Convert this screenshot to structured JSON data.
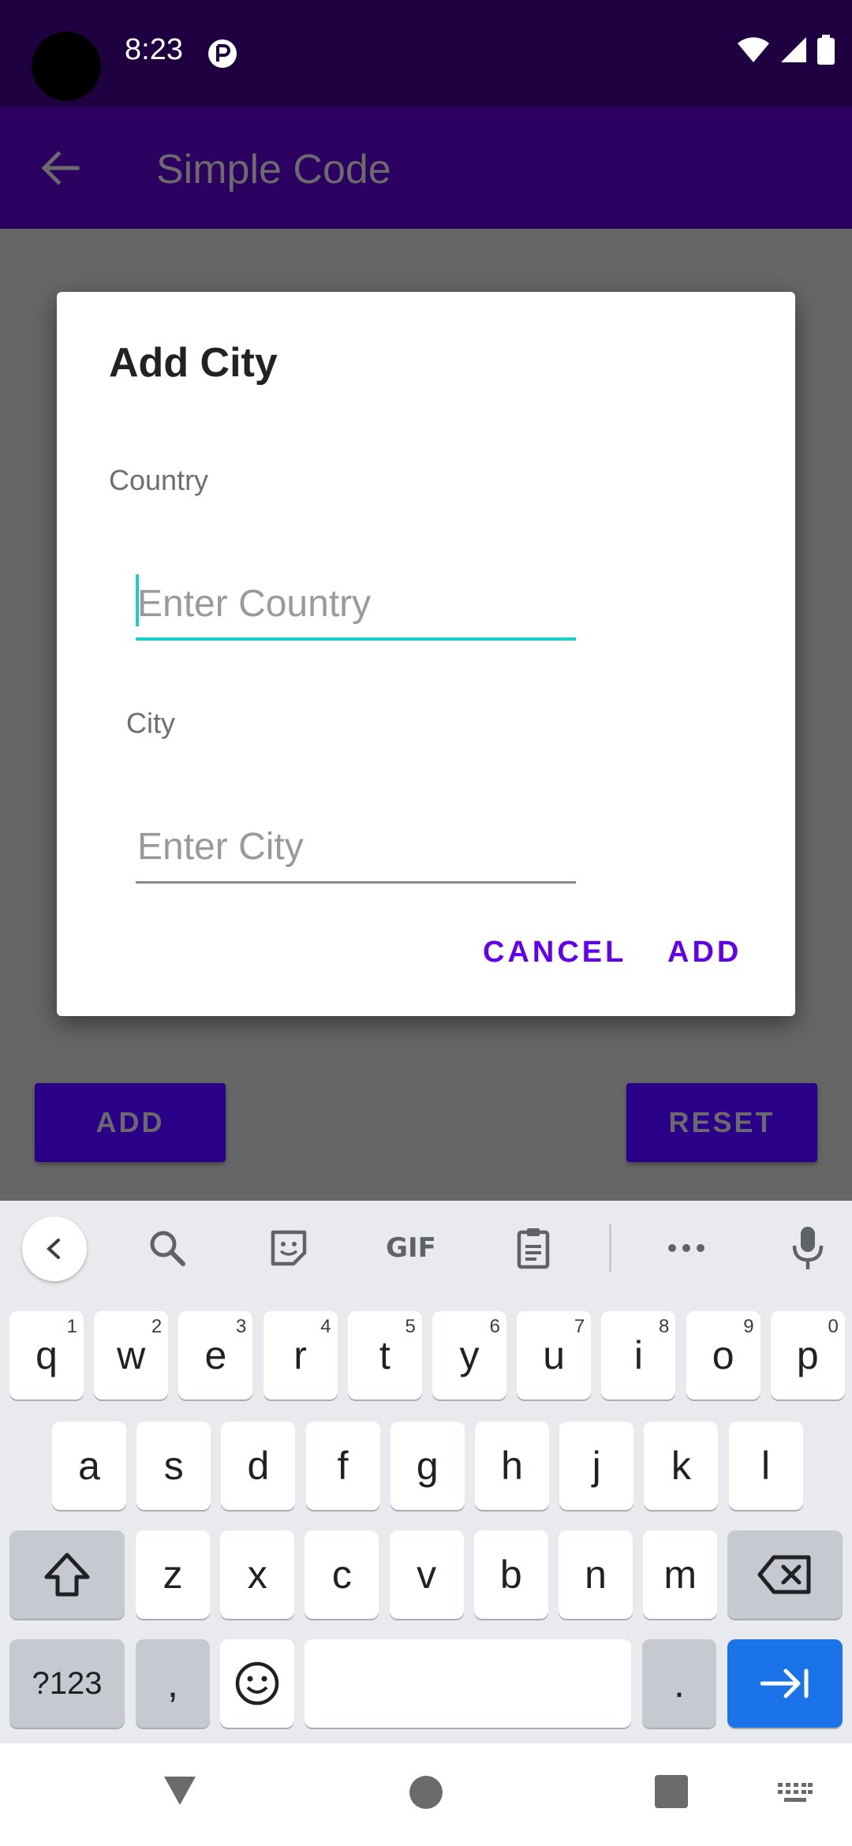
{
  "status_bar": {
    "time": "8:23"
  },
  "app_bar": {
    "title": "Simple Code"
  },
  "main": {
    "add_button": "ADD",
    "reset_button": "RESET"
  },
  "dialog": {
    "title": "Add City",
    "country_label": "Country",
    "country_placeholder": "Enter Country",
    "country_value": "",
    "city_label": "City",
    "city_placeholder": "Enter City",
    "city_value": "",
    "cancel_button": "CANCEL",
    "add_button": "ADD"
  },
  "keyboard": {
    "suggestion_icons": [
      "back-icon",
      "search-icon",
      "sticker-icon",
      "gif-icon",
      "clipboard-icon",
      "more-icon",
      "microphone-icon"
    ],
    "gif_label": "GIF",
    "row1": [
      {
        "k": "q",
        "h": "1"
      },
      {
        "k": "w",
        "h": "2"
      },
      {
        "k": "e",
        "h": "3"
      },
      {
        "k": "r",
        "h": "4"
      },
      {
        "k": "t",
        "h": "5"
      },
      {
        "k": "y",
        "h": "6"
      },
      {
        "k": "u",
        "h": "7"
      },
      {
        "k": "i",
        "h": "8"
      },
      {
        "k": "o",
        "h": "9"
      },
      {
        "k": "p",
        "h": "0"
      }
    ],
    "row2": [
      "a",
      "s",
      "d",
      "f",
      "g",
      "h",
      "j",
      "k",
      "l"
    ],
    "row3": [
      "z",
      "x",
      "c",
      "v",
      "b",
      "n",
      "m"
    ],
    "symbols_key": "?123",
    "comma_key": ",",
    "period_key": "."
  },
  "colors": {
    "status_bar": "#1f0040",
    "app_bar": "#2c0060",
    "accent": "#6200ee",
    "input_focus": "#19d0c4",
    "enter_key": "#1a73e8"
  }
}
